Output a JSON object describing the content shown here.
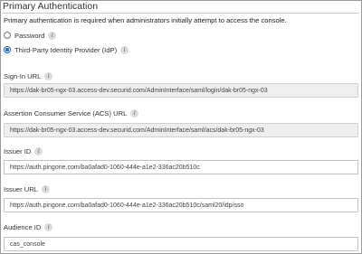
{
  "section": {
    "title": "Primary Authentication",
    "description": "Primary authentication is required when administrators initially attempt to access the console."
  },
  "auth_options": [
    {
      "label": "Password",
      "selected": false
    },
    {
      "label": "Third-Party Identity Provider (IdP)",
      "selected": true
    }
  ],
  "info_icon_glyph": "i",
  "fields": {
    "sign_in_url": {
      "label": "Sign-In URL",
      "value": "https://dak-br05-ngx-03.access-dev.securid.com/AdminInterface/saml/login/dak-br05-ngx-03"
    },
    "acs_url": {
      "label": "Assertion Consumer Service (ACS) URL",
      "value": "https://dak-br05-ngx-03.access-dev.securid.com/AdminInterface/saml/acs/dak-br05-ngx-03"
    },
    "issuer_id": {
      "label": "Issuer ID",
      "value": "https://auth.pingone.com/ba0afad0-1060-444e-a1e2-336ac20b510c"
    },
    "issuer_url": {
      "label": "Issuer URL",
      "value": "https://auth.pingone.com/ba0afad0-1060-444e-a1e2-336ac20b510c/saml20/idp/sso"
    },
    "audience_id": {
      "label": "Audience ID",
      "value": "cas_console"
    }
  }
}
